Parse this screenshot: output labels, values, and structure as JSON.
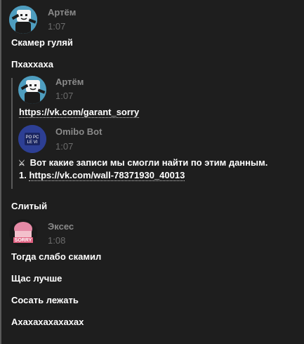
{
  "messages": [
    {
      "author": "Артём",
      "time": "1:07",
      "avatar_icon": "marshmello-dab-avatar"
    },
    {
      "text": "Скамер гуляй"
    },
    {
      "text": "Пхаххаха"
    },
    {
      "text": "Слитый"
    },
    {
      "author": "Эксес",
      "time": "1:08",
      "avatar_icon": "sorry-anime-avatar"
    },
    {
      "text": "Тогда слабо скамил"
    },
    {
      "text": "Щас лучше"
    },
    {
      "text": "Сосать лежать"
    },
    {
      "text": "Ахахахахахахах"
    }
  ],
  "forwarded": {
    "first": {
      "author": "Артём",
      "time": "1:07",
      "link": "https://vk.com/garant_sorry",
      "avatar_icon": "marshmello-dab-avatar"
    },
    "second": {
      "author": "Omibo Bot",
      "time": "1:07",
      "avatar_icon": "omibo-bot-avatar",
      "icon": "crossed-swords-icon",
      "line1": "Вот какие записи мы смогли найти по этим данным.",
      "line2_prefix": "1.",
      "line2_link": "https://vk.com/wall-78371930_40013"
    }
  },
  "colors": {
    "background": "#1e1e1e",
    "author": "#8a8a8a",
    "time": "#6c6c6c",
    "text": "#ffffff",
    "thread_line": "#5a5a5a"
  }
}
